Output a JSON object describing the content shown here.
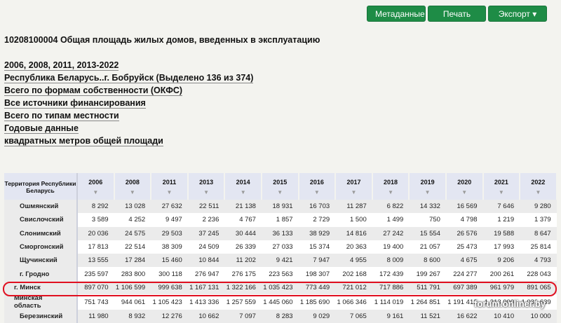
{
  "toolbar": {
    "metadata": "Метаданные",
    "print": "Печать",
    "export": "Экспорт ▾"
  },
  "title": "10208100004 Общая площадь жилых домов, введенных в эксплуатацию",
  "filters": [
    "2006, 2008, 2011, 2013-2022",
    "Республика Беларусь..г. Бобруйск (Выделено 136 из 374)",
    "Всего по формам собственности (ОКФС)",
    "Все источники финансирования",
    "Всего по типам местности",
    "Годовые данные",
    "квадратных метров общей площади"
  ],
  "table": {
    "corner": "Территория Республики Беларусь",
    "years": [
      "2006",
      "2008",
      "2011",
      "2013",
      "2014",
      "2015",
      "2016",
      "2017",
      "2018",
      "2019",
      "2020",
      "2021",
      "2022"
    ],
    "rows": [
      {
        "name": "Ошмянский",
        "values": [
          "8 292",
          "13 028",
          "27 632",
          "22 511",
          "21 138",
          "18 931",
          "16 703",
          "11 287",
          "6 822",
          "14 332",
          "16 569",
          "7 646",
          "9 280"
        ]
      },
      {
        "name": "Свислочский",
        "values": [
          "3 589",
          "4 252",
          "9 497",
          "2 236",
          "4 767",
          "1 857",
          "2 729",
          "1 500",
          "1 499",
          "750",
          "4 798",
          "1 219",
          "1 379"
        ]
      },
      {
        "name": "Слонимский",
        "values": [
          "20 036",
          "24 575",
          "29 503",
          "37 245",
          "30 444",
          "36 133",
          "38 929",
          "14 816",
          "27 242",
          "15 554",
          "26 576",
          "19 588",
          "8 647"
        ]
      },
      {
        "name": "Сморгонский",
        "values": [
          "17 813",
          "22 514",
          "38 309",
          "24 509",
          "26 339",
          "27 033",
          "15 374",
          "20 363",
          "19 400",
          "21 057",
          "25 473",
          "17 993",
          "25 814"
        ]
      },
      {
        "name": "Щучинский",
        "values": [
          "13 555",
          "17 284",
          "15 460",
          "10 844",
          "11 202",
          "9 421",
          "7 947",
          "4 955",
          "8 009",
          "8 600",
          "4 675",
          "9 206",
          "4 793"
        ]
      },
      {
        "name": "г. Гродно",
        "values": [
          "235 597",
          "283 800",
          "300 118",
          "276 947",
          "276 175",
          "223 563",
          "198 307",
          "202 168",
          "172 439",
          "199 267",
          "224 277",
          "200 261",
          "228 043"
        ]
      },
      {
        "name": "г. Минск",
        "level": 0,
        "values": [
          "897 070",
          "1 106 599",
          "999 638",
          "1 167 131",
          "1 322 166",
          "1 035 423",
          "773 449",
          "721 012",
          "717 886",
          "511 791",
          "697 389",
          "961 979",
          "891 065"
        ]
      },
      {
        "name": "Минская область",
        "level": 0,
        "values": [
          "751 743",
          "944 061",
          "1 105 423",
          "1 413 336",
          "1 257 559",
          "1 445 060",
          "1 185 690",
          "1 066 346",
          "1 114 019",
          "1 264 851",
          "1 191 412",
          "1 213 000",
          "1 031 639"
        ]
      },
      {
        "name": "Березинский",
        "values": [
          "11 980",
          "8 932",
          "12 276",
          "10 662",
          "7 097",
          "8 283",
          "9 029",
          "7 065",
          "9 161",
          "11 521",
          "16 622",
          "10 410",
          "10 000"
        ]
      }
    ]
  },
  "watermark": "forum.onliner.by"
}
